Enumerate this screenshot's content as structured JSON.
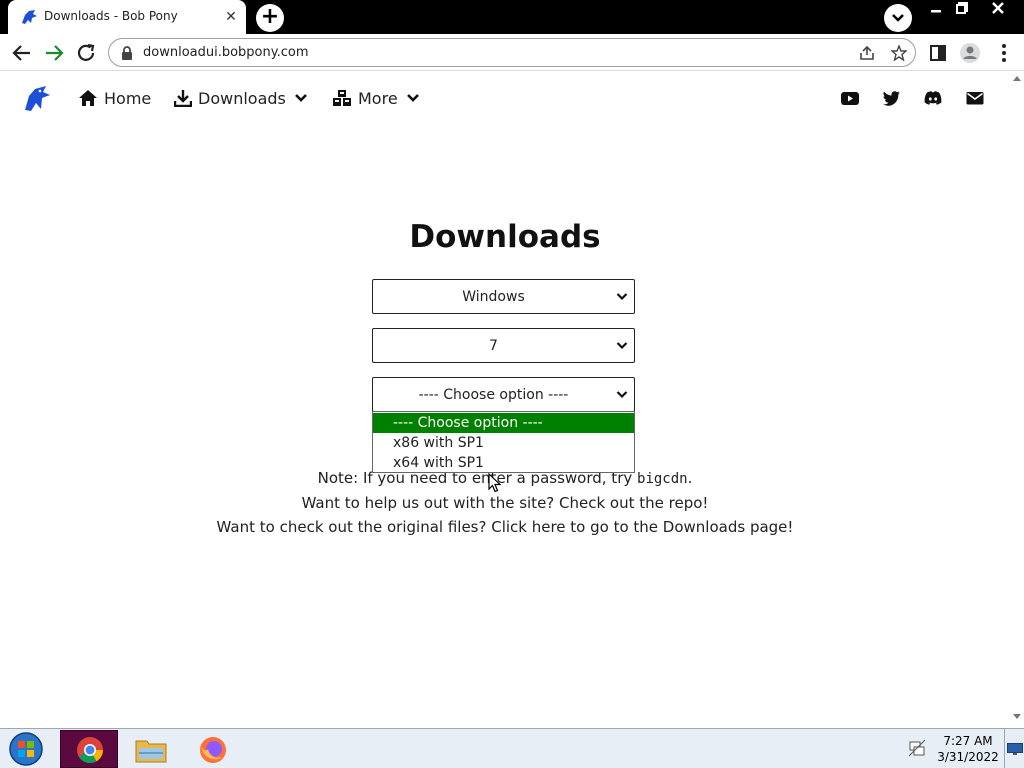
{
  "browser": {
    "tab_title": "Downloads - Bob Pony",
    "url": "downloadui.bobpony.com"
  },
  "nav": {
    "home": "Home",
    "downloads": "Downloads",
    "more": "More",
    "social_icons": [
      "youtube-icon",
      "twitter-icon",
      "discord-icon",
      "mail-icon"
    ]
  },
  "main": {
    "title": "Downloads",
    "selects": [
      {
        "value": "Windows"
      },
      {
        "value": "7"
      },
      {
        "value": "---- Choose option ----"
      }
    ],
    "dropdown_options": [
      "---- Choose option ----",
      "x86 with SP1",
      "x64 with SP1"
    ],
    "note_prefix": "Note: If you need to enter a password, try ",
    "note_code": "bigcdn",
    "note_suffix": ".",
    "line2": "Want to help us out with the site? Check out the repo!",
    "line3": "Want to check out the original files? Click here to go to the Downloads page!"
  },
  "taskbar": {
    "time": "7:27 AM",
    "date": "3/31/2022"
  },
  "colors": {
    "selected_option": "#008000",
    "logo": "#1e4fd8"
  }
}
